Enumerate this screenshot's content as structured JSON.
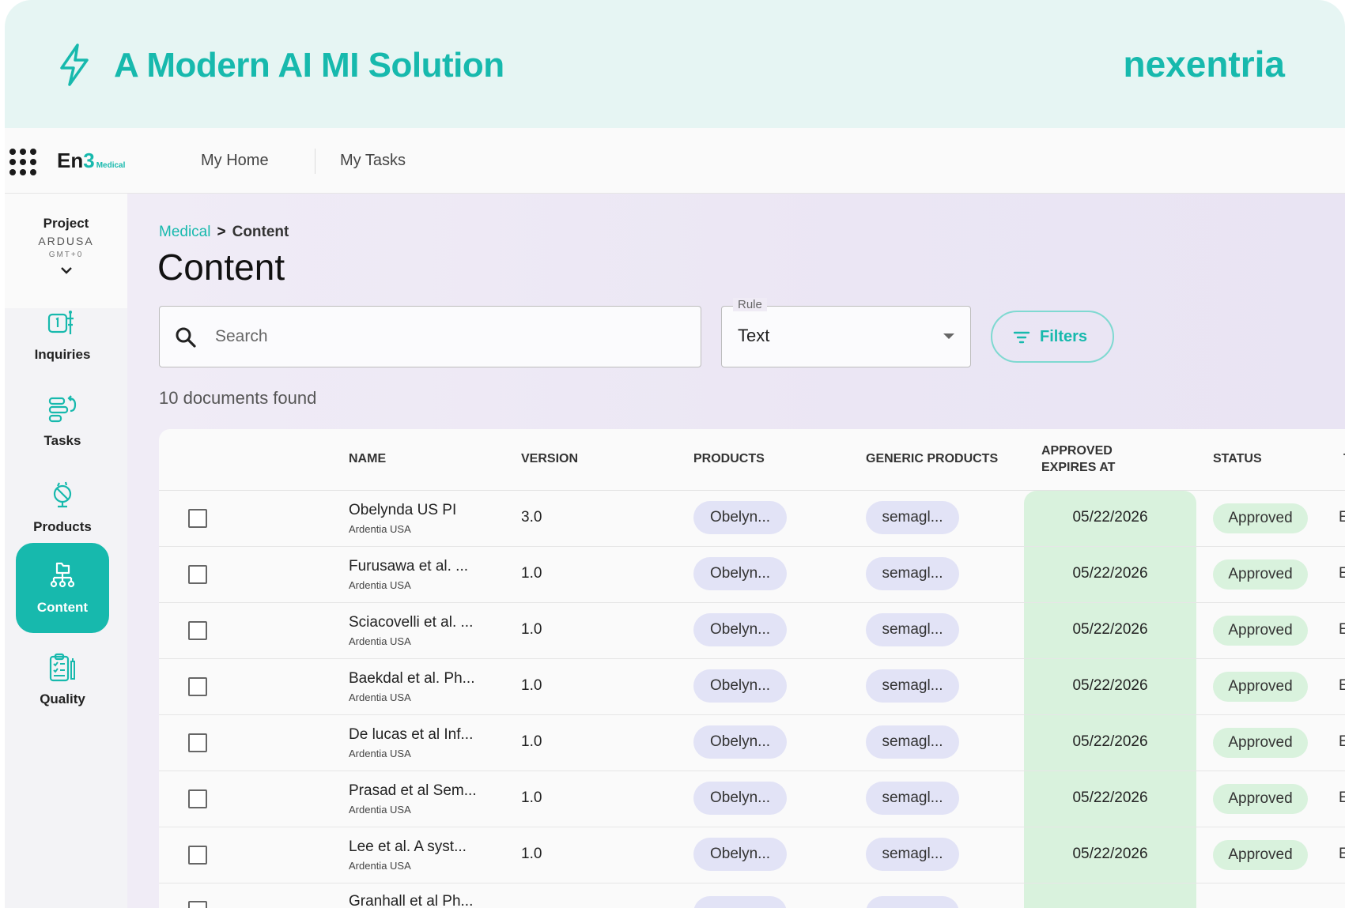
{
  "banner": {
    "headline": "A Modern AI MI Solution",
    "brand": "nexentria"
  },
  "topbar": {
    "logo_main": "En",
    "logo_num": "3",
    "logo_sub": "Medical",
    "nav": [
      "My Home",
      "My Tasks"
    ]
  },
  "project": {
    "label": "Project",
    "name": "ARDUSA",
    "timezone": "GMT+0"
  },
  "sidebar": {
    "items": [
      {
        "label": "Inquiries",
        "icon": "inquiries-icon",
        "active": false
      },
      {
        "label": "Tasks",
        "icon": "tasks-icon",
        "active": false
      },
      {
        "label": "Products",
        "icon": "products-icon",
        "active": false
      },
      {
        "label": "Content",
        "icon": "content-icon",
        "active": true
      },
      {
        "label": "Quality",
        "icon": "quality-icon",
        "active": false
      }
    ]
  },
  "breadcrumb": {
    "root": "Medical",
    "separator": ">",
    "current": "Content"
  },
  "page": {
    "title": "Content"
  },
  "search": {
    "placeholder": "Search",
    "value": ""
  },
  "rule": {
    "label": "Rule",
    "value": "Text"
  },
  "filters": {
    "label": "Filters"
  },
  "results": {
    "count_text": "10 documents found"
  },
  "table": {
    "columns": {
      "name": "NAME",
      "version": "VERSION",
      "products": "PRODUCTS",
      "generic_products": "GENERIC PRODUCTS",
      "approved_expires_line1": "APPROVED",
      "approved_expires_line2": "EXPIRES AT",
      "status": "STATUS",
      "next_partial": "T"
    },
    "rows": [
      {
        "name": "Obelynda US PI",
        "org": "Ardentia USA",
        "version": "3.0",
        "product": "Obelyn...",
        "generic": "semagl...",
        "expires": "05/22/2026",
        "status": "Approved",
        "edge": "E"
      },
      {
        "name": "Furusawa et al. ...",
        "org": "Ardentia USA",
        "version": "1.0",
        "product": "Obelyn...",
        "generic": "semagl...",
        "expires": "05/22/2026",
        "status": "Approved",
        "edge": "E"
      },
      {
        "name": "Sciacovelli et al. ...",
        "org": "Ardentia USA",
        "version": "1.0",
        "product": "Obelyn...",
        "generic": "semagl...",
        "expires": "05/22/2026",
        "status": "Approved",
        "edge": "E"
      },
      {
        "name": "Baekdal et al. Ph...",
        "org": "Ardentia USA",
        "version": "1.0",
        "product": "Obelyn...",
        "generic": "semagl...",
        "expires": "05/22/2026",
        "status": "Approved",
        "edge": "E"
      },
      {
        "name": "De lucas et al Inf...",
        "org": "Ardentia USA",
        "version": "1.0",
        "product": "Obelyn...",
        "generic": "semagl...",
        "expires": "05/22/2026",
        "status": "Approved",
        "edge": "E"
      },
      {
        "name": "Prasad et al Sem...",
        "org": "Ardentia USA",
        "version": "1.0",
        "product": "Obelyn...",
        "generic": "semagl...",
        "expires": "05/22/2026",
        "status": "Approved",
        "edge": "E"
      },
      {
        "name": "Lee et al. A syst...",
        "org": "Ardentia USA",
        "version": "1.0",
        "product": "Obelyn...",
        "generic": "semagl...",
        "expires": "05/22/2026",
        "status": "Approved",
        "edge": "E"
      },
      {
        "name": "Granhall et al Ph...",
        "org": "",
        "version": "",
        "product": "",
        "generic": "",
        "expires": "",
        "status": "",
        "edge": ""
      }
    ]
  },
  "colors": {
    "accent": "#17b9ad",
    "banner_bg": "#e6f5f3",
    "pill_bg": "#e2e3f6",
    "approved_bg": "#d9f2dd"
  }
}
